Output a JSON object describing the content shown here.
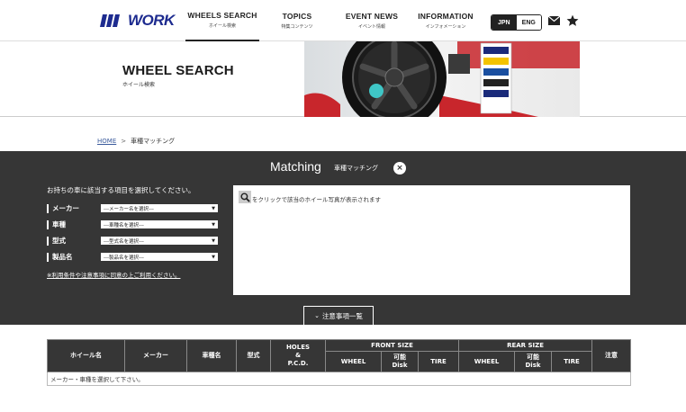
{
  "header": {
    "logo": "WORK",
    "nav": [
      {
        "en": "WHEELS SEARCH",
        "jp": "ホイール検索",
        "active": true
      },
      {
        "en": "TOPICS",
        "jp": "特集コンテンツ",
        "active": false
      },
      {
        "en": "EVENT NEWS",
        "jp": "イベント情報",
        "active": false
      },
      {
        "en": "INFORMATION",
        "jp": "インフォメーション",
        "active": false
      }
    ],
    "lang_jpn": "JPN",
    "lang_eng": "ENG"
  },
  "hero": {
    "title": "WHEEL SEARCH",
    "subtitle": "ホイール検索"
  },
  "breadcrumb": {
    "home": "HOME",
    "separator": ">",
    "current": "車種マッチング"
  },
  "matching": {
    "title": "Matching",
    "subtitle": "車種マッチング",
    "close_icon": "×",
    "intro": "お持ちの車に該当する項目を選択してください。",
    "fields": [
      {
        "label": "メーカー",
        "placeholder": "---メーカー名を選択---"
      },
      {
        "label": "車種",
        "placeholder": "---車種名を選択---"
      },
      {
        "label": "型式",
        "placeholder": "---型式名を選択---"
      },
      {
        "label": "製品名",
        "placeholder": "---製品名を選択---"
      }
    ],
    "terms": "※利用条件や注意事項に同意の上ご利用ください。",
    "result_text": "をクリックで該当のホイール写真が表示されます",
    "notes_button": "注意事項一覧"
  },
  "table": {
    "headers": {
      "wheel_name": "ホイール名",
      "maker": "メーカー",
      "car": "車種名",
      "model": "型式",
      "holes_1": "HOLES",
      "holes_2": "&",
      "holes_3": "P.C.D.",
      "front": "FRONT SIZE",
      "rear": "REAR SIZE",
      "notes": "注意",
      "wheel": "WHEEL",
      "disk_1": "可能",
      "disk_2": "Disk",
      "tire": "TIRE"
    },
    "empty_message": "メーカー・車種を選択して下さい。"
  },
  "colors": {
    "panel_bg": "#363636",
    "logo_blue": "#1d2b8f",
    "link_blue": "#3b5b9c"
  }
}
